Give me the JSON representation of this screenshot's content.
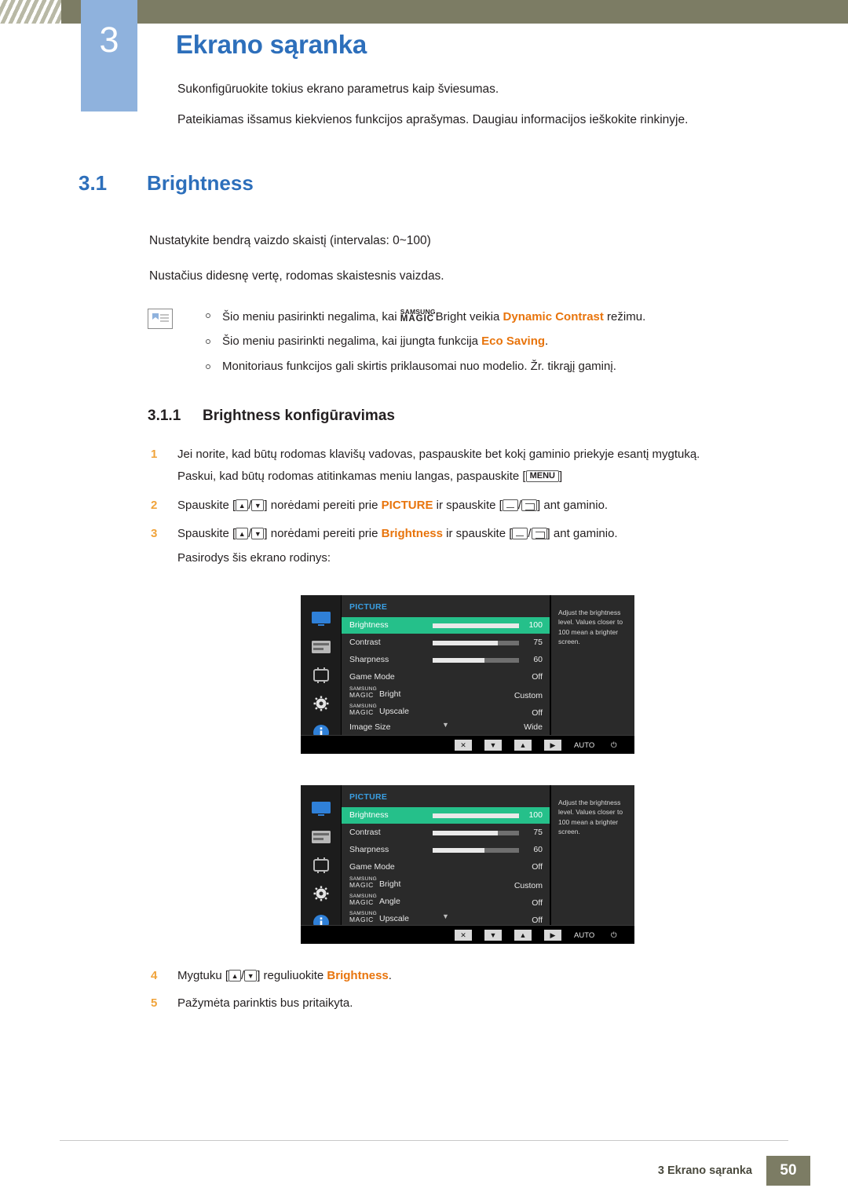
{
  "header": {
    "chapter_number": "3",
    "chapter_title": "Ekrano sąranka",
    "line1": "Sukonfigūruokite tokius ekrano parametrus kaip šviesumas.",
    "line2": "Pateikiamas išsamus kiekvienos funkcijos aprašymas. Daugiau informacijos ieškokite rinkinyje."
  },
  "section": {
    "number": "3.1",
    "title": "Brightness",
    "paragraph1": "Nustatykite bendrą vaizdo skaistį (intervalas: 0~100)",
    "paragraph2": "Nustačius didesnę vertę, rodomas skaistesnis vaizdas."
  },
  "notes": [
    {
      "pre": "Šio meniu pasirinkti negalima, kai ",
      "magic_small": "SAMSUNG",
      "magic_large": "MAGIC",
      "mid": "Bright",
      "post_plain": " veikia ",
      "highlight": "Dynamic Contrast",
      "tail": " režimu."
    },
    {
      "pre": "Šio meniu pasirinkti negalima, kai įjungta funkcija ",
      "highlight": "Eco Saving",
      "tail": "."
    },
    {
      "pre": "Monitoriaus funkcijos gali skirtis priklausomai nuo modelio. Žr. tikrąjį gaminį."
    }
  ],
  "subsection": {
    "number": "3.1.1",
    "title": "Brightness konfigūravimas"
  },
  "steps": {
    "s1_num": "1",
    "s1_line1": "Jei norite, kad būtų rodomas klavišų vadovas, paspauskite bet kokį gaminio priekyje esantį mygtuką.",
    "s1_line2a": "Paskui, kad būtų rodomas atitinkamas meniu langas, paspauskite [",
    "s1_key": "MENU",
    "s1_line2b": "]",
    "s2_num": "2",
    "s2_a": "Spauskite [",
    "s2_b": "/",
    "s2_c": "] norėdami pereiti prie ",
    "s2_highlight": "PICTURE",
    "s2_d": " ir spauskite [",
    "s2_e": "/",
    "s2_f": "] ant gaminio.",
    "s3_num": "3",
    "s3_a": "Spauskite [",
    "s3_b": "/",
    "s3_c": "] norėdami pereiti prie ",
    "s3_highlight": "Brightness",
    "s3_d": " ir spauskite [",
    "s3_e": "/",
    "s3_f": "] ant gaminio.",
    "s3_line2": "Pasirodys šis ekrano rodinys:",
    "s4_num": "4",
    "s4_a": "Mygtuku [",
    "s4_b": "/",
    "s4_c": "] reguliuokite ",
    "s4_highlight": "Brightness",
    "s4_d": ".",
    "s5_num": "5",
    "s5_text": "Pažymėta parinktis bus pritaikyta."
  },
  "osd1": {
    "title": "PICTURE",
    "help": "Adjust the brightness level. Values closer to 100 mean a brighter screen.",
    "rows": [
      {
        "label": "Brightness",
        "value": "100",
        "bar": 100,
        "selected": true
      },
      {
        "label": "Contrast",
        "value": "75",
        "bar": 75,
        "selected": false
      },
      {
        "label": "Sharpness",
        "value": "60",
        "bar": 60,
        "selected": false
      },
      {
        "label": "Game Mode",
        "value": "Off",
        "bar": null,
        "selected": false
      }
    ],
    "magic_rows": [
      {
        "small": "SAMSUNG",
        "large": "MAGIC",
        "rest": "Bright",
        "value": "Custom"
      },
      {
        "small": "SAMSUNG",
        "large": "MAGIC",
        "rest": "Upscale",
        "value": "Off"
      }
    ],
    "last_row": {
      "label": "Image Size",
      "value": "Wide"
    },
    "footer": {
      "btn1": "✕",
      "btn2": "▼",
      "btn3": "▲",
      "btn4": "▶",
      "auto": "AUTO",
      "power": "⏻"
    }
  },
  "osd2": {
    "title": "PICTURE",
    "help": "Adjust the brightness level. Values closer to 100 mean a brighter screen.",
    "rows": [
      {
        "label": "Brightness",
        "value": "100",
        "bar": 100,
        "selected": true
      },
      {
        "label": "Contrast",
        "value": "75",
        "bar": 75,
        "selected": false
      },
      {
        "label": "Sharpness",
        "value": "60",
        "bar": 60,
        "selected": false
      },
      {
        "label": "Game Mode",
        "value": "Off",
        "bar": null,
        "selected": false
      }
    ],
    "magic_rows": [
      {
        "small": "SAMSUNG",
        "large": "MAGIC",
        "rest": "Bright",
        "value": "Custom"
      },
      {
        "small": "SAMSUNG",
        "large": "MAGIC",
        "rest": "Angle",
        "value": "Off"
      },
      {
        "small": "SAMSUNG",
        "large": "MAGIC",
        "rest": "Upscale",
        "value": "Off"
      }
    ],
    "footer": {
      "btn1": "✕",
      "btn2": "▼",
      "btn3": "▲",
      "btn4": "▶",
      "auto": "AUTO",
      "power": "⏻"
    }
  },
  "footer": {
    "text": "3 Ekrano sąranka",
    "page": "50"
  },
  "colors": {
    "accent_blue": "#2d6fbb",
    "chapter_box": "#8fb2dd",
    "band": "#7c7c64",
    "orange": "#e8740c",
    "osd_select": "#25c08a"
  }
}
